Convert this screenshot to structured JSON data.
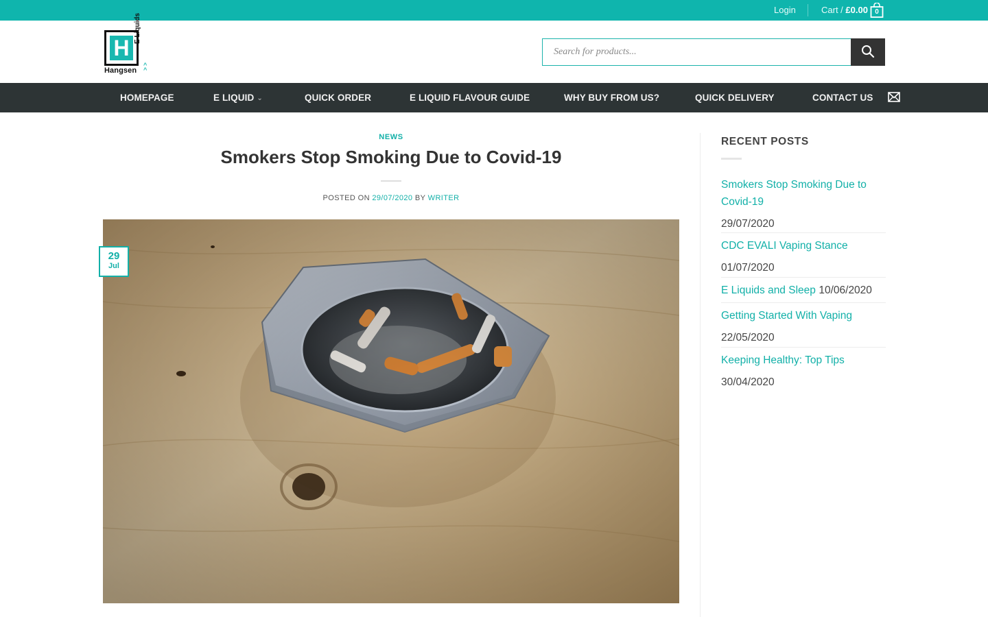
{
  "topbar": {
    "login": "Login",
    "cart_label": "Cart /",
    "cart_total": "£0.00",
    "cart_count": "0"
  },
  "header": {
    "brand": "Hangsen",
    "brand_sub": "E Liquids",
    "search_placeholder": "Search for products..."
  },
  "nav": {
    "items": [
      {
        "label": "HOMEPAGE"
      },
      {
        "label": "E LIQUID"
      },
      {
        "label": "QUICK ORDER"
      },
      {
        "label": "E LIQUID FLAVOUR GUIDE"
      },
      {
        "label": "WHY BUY FROM US?"
      },
      {
        "label": "QUICK DELIVERY"
      },
      {
        "label": "CONTACT US"
      }
    ]
  },
  "post": {
    "category": "NEWS",
    "title": "Smokers Stop Smoking Due to Covid-19",
    "posted_on": "POSTED ON",
    "date": "29/07/2020",
    "by": "BY",
    "author": "WRITER",
    "badge_day": "29",
    "badge_month": "Jul"
  },
  "sidebar": {
    "heading": "RECENT POSTS",
    "posts": [
      {
        "title": "Smokers Stop Smoking Due to Covid-19",
        "date": "29/07/2020"
      },
      {
        "title": "CDC EVALI Vaping Stance",
        "date": "01/07/2020"
      },
      {
        "title": "E Liquids and Sleep",
        "date": "10/06/2020"
      },
      {
        "title": "Getting Started With Vaping",
        "date": "22/05/2020"
      },
      {
        "title": "Keeping Healthy: Top Tips",
        "date": "30/04/2020"
      }
    ]
  },
  "colors": {
    "accent": "#0fb5ad",
    "nav_bg": "#2d3435",
    "search_button": "#333333"
  }
}
